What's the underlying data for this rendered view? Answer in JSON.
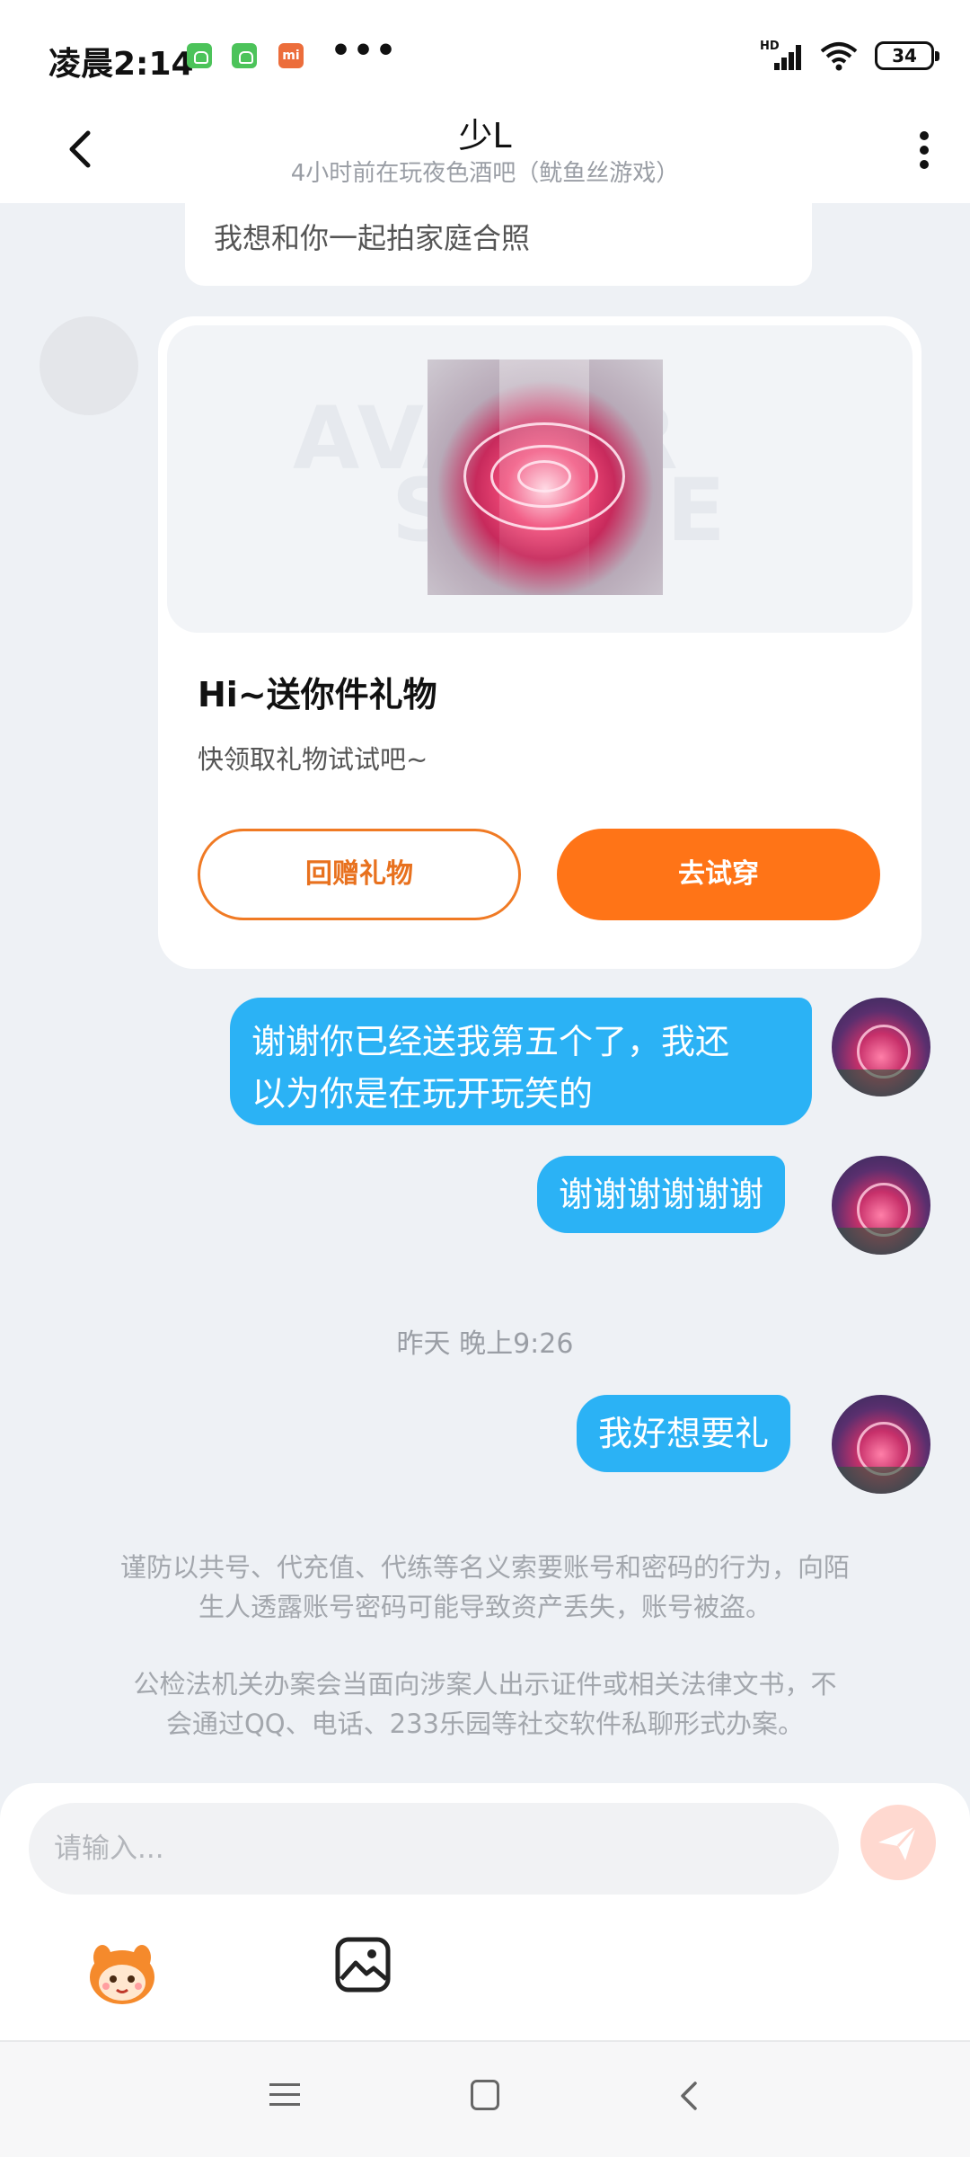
{
  "status_bar": {
    "time": "凌晨2:14",
    "more": "•••",
    "notification_badge": "mi",
    "network_label": "HD",
    "battery": "34"
  },
  "header": {
    "title": "少L",
    "subtitle": "4小时前在玩夜色酒吧（鱿鱼丝游戏）"
  },
  "messages": {
    "previous_text": "我想和你一起拍家庭合照",
    "gift_card": {
      "title": "Hi~送你件礼物",
      "description": "快领取礼物试试吧~",
      "return_button": "回赠礼物",
      "tryon_button": "去试穿"
    },
    "my_messages": [
      {
        "text_line1": "谢谢你已经送我第五个了，我还",
        "text_line2": "以为你是在玩开玩笑的"
      },
      {
        "text": "谢谢谢谢谢谢"
      },
      {
        "text": "我好想要礼"
      }
    ],
    "timestamp": "昨天 晚上9:26"
  },
  "notices": [
    {
      "line1": "谨防以共号、代充值、代练等名义索要账号和密码的行为，向陌",
      "line2": "生人透露账号密码可能导致资产丢失，账号被盗。"
    },
    {
      "line1": "公检法机关办案会当面向涉案人出示证件或相关法律文书，不",
      "line2": "会通过QQ、电话、233乐园等社交软件私聊形式办案。"
    }
  ],
  "input": {
    "placeholder": "请输入..."
  },
  "colors": {
    "accent_orange": "#ff7417",
    "bubble_blue": "#2bb2f5",
    "background": "#eef1f5"
  }
}
